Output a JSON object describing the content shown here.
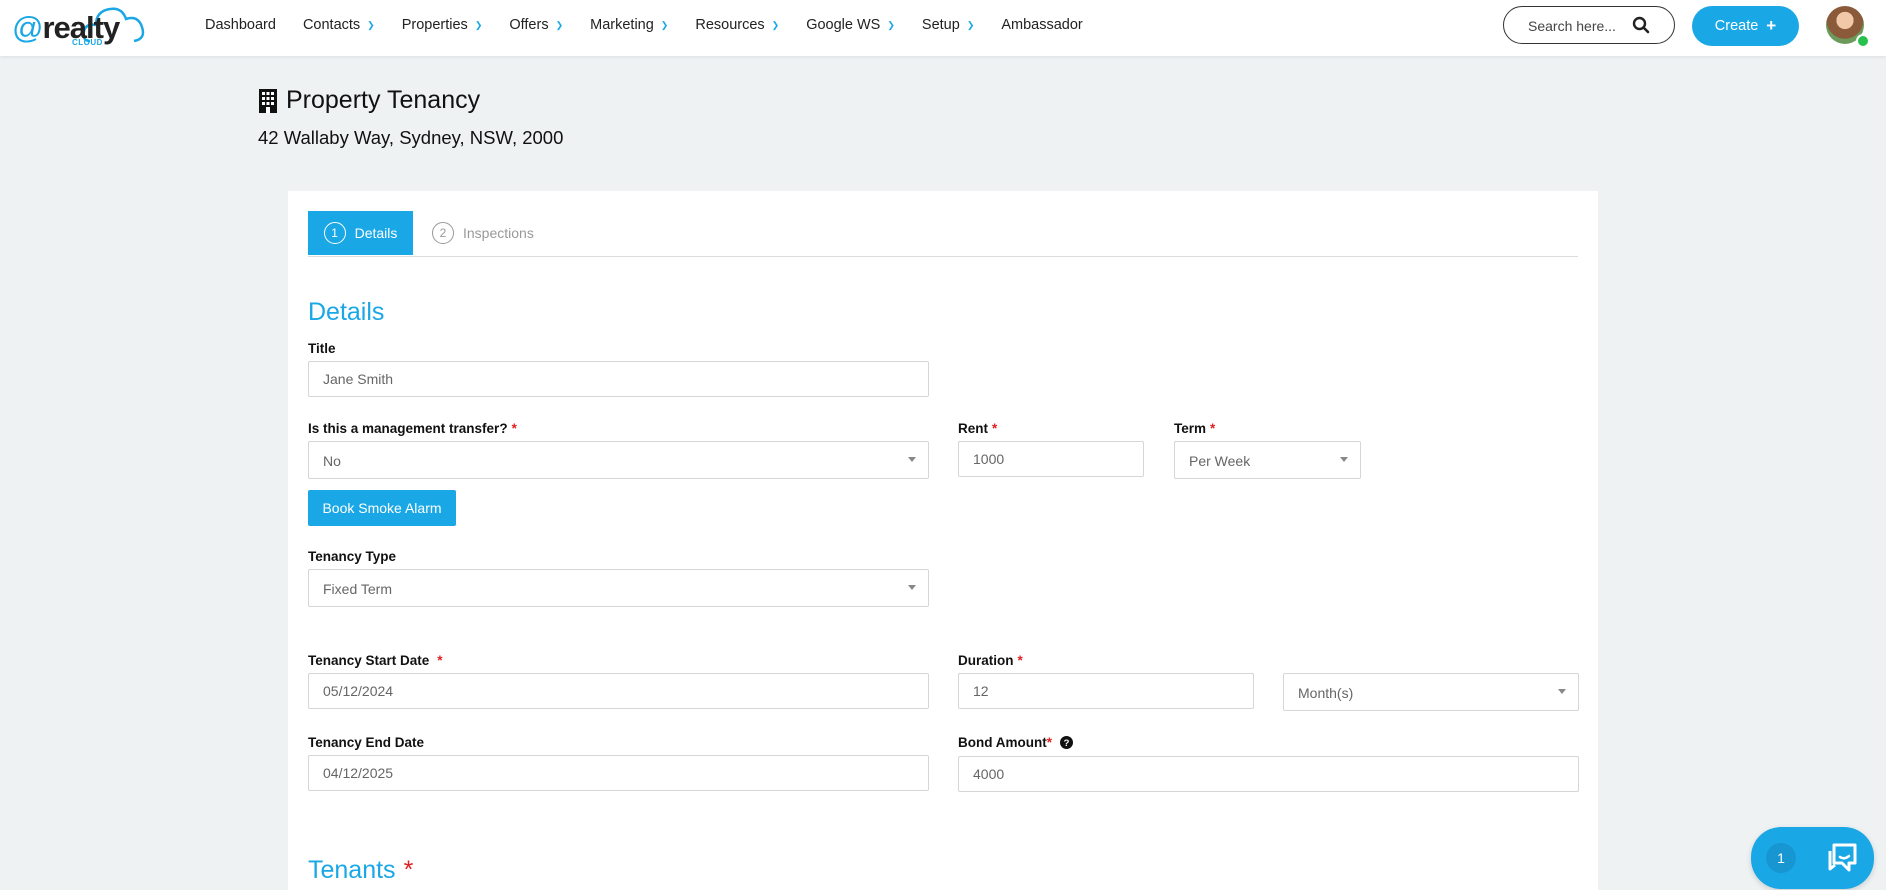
{
  "brand": {
    "logo_prefix": "@",
    "logo_name": "realty",
    "logo_sub": "CLOUD",
    "accent_color": "#1aa7e6"
  },
  "nav": {
    "items": [
      {
        "label": "Dashboard",
        "has_dropdown": false
      },
      {
        "label": "Contacts",
        "has_dropdown": true
      },
      {
        "label": "Properties",
        "has_dropdown": true
      },
      {
        "label": "Offers",
        "has_dropdown": true
      },
      {
        "label": "Marketing",
        "has_dropdown": true
      },
      {
        "label": "Resources",
        "has_dropdown": true
      },
      {
        "label": "Google WS",
        "has_dropdown": true
      },
      {
        "label": "Setup",
        "has_dropdown": true
      },
      {
        "label": "Ambassador",
        "has_dropdown": false
      }
    ],
    "search_placeholder": "Search here...",
    "create_label": "Create",
    "create_icon": "+",
    "avatar_icon": "user-avatar"
  },
  "page": {
    "title": "Property Tenancy",
    "title_icon": "building-icon",
    "address": "42 Wallaby Way, Sydney, NSW, 2000"
  },
  "tabs": [
    {
      "num": "1",
      "label": "Details",
      "active": true
    },
    {
      "num": "2",
      "label": "Inspections",
      "active": false
    }
  ],
  "form": {
    "section_details": "Details",
    "title_label": "Title",
    "title_value": "Jane Smith",
    "transfer_label": "Is this a management transfer?",
    "transfer_value": "No",
    "rent_label": "Rent",
    "rent_value": "1000",
    "term_label": "Term",
    "term_value": "Per Week",
    "smoke_button": "Book Smoke Alarm",
    "tenancy_type_label": "Tenancy Type",
    "tenancy_type_value": "Fixed Term",
    "start_label": "Tenancy Start Date",
    "start_value": "05/12/2024",
    "duration_label": "Duration",
    "duration_value": "12",
    "duration_unit_value": "Month(s)",
    "end_label": "Tenancy End Date",
    "end_value": "04/12/2025",
    "bond_label": "Bond Amount",
    "bond_value": "4000",
    "required_mark": "*",
    "section_tenants": "Tenants"
  },
  "chat": {
    "count": "1",
    "icon": "chat-icon"
  }
}
